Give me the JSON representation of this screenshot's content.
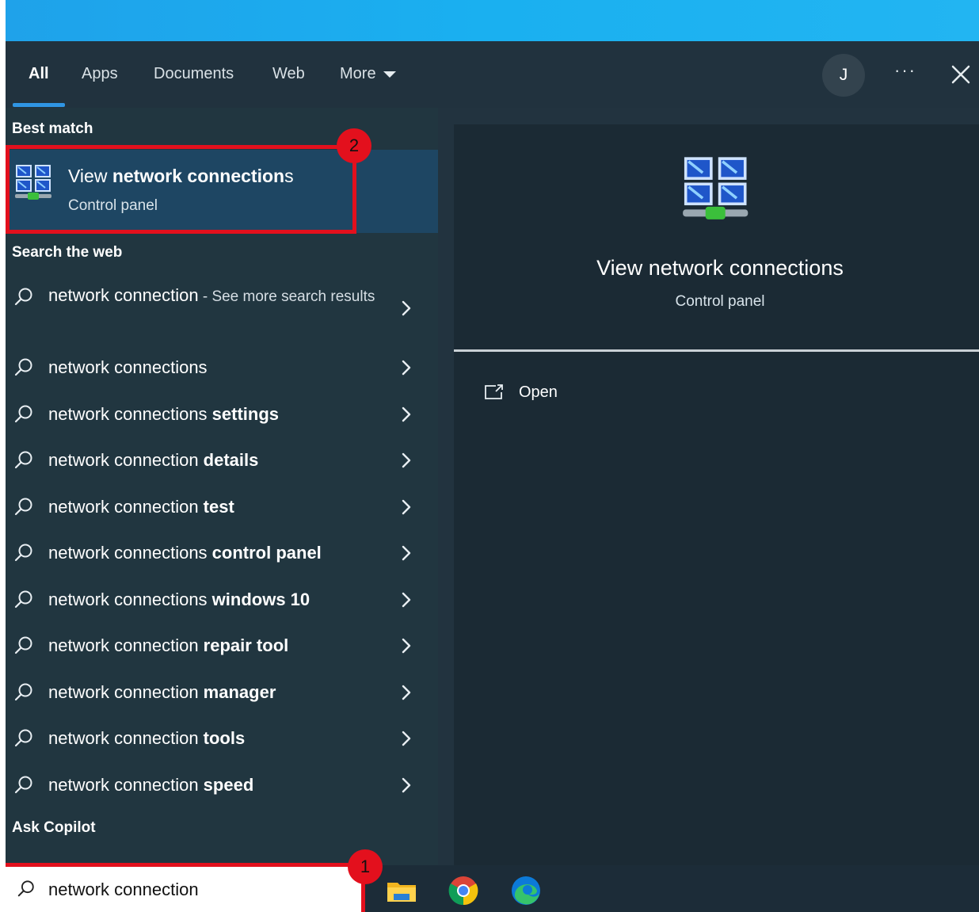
{
  "tabs": [
    {
      "label": "All",
      "active": true
    },
    {
      "label": "Apps"
    },
    {
      "label": "Documents"
    },
    {
      "label": "Web"
    },
    {
      "label": "More"
    }
  ],
  "user": {
    "initial": "J"
  },
  "more_options": "···",
  "sections": {
    "best_match": "Best match",
    "search_web": "Search the web",
    "ask_copilot": "Ask Copilot"
  },
  "best_match": {
    "title_plain": "View ",
    "title_bold": "network connection",
    "title_tail": "s",
    "subtitle": "Control panel"
  },
  "web_results": [
    {
      "prefix": "network connection",
      "suffix": " - See more search results",
      "bold": ""
    },
    {
      "prefix": "network connections",
      "bold": ""
    },
    {
      "prefix": "network connections ",
      "bold": "settings"
    },
    {
      "prefix": "network connection ",
      "bold": "details"
    },
    {
      "prefix": "network connection ",
      "bold": "test"
    },
    {
      "prefix": "network connections ",
      "bold": "control panel"
    },
    {
      "prefix": "network connections ",
      "bold": "windows 10"
    },
    {
      "prefix": "network connection ",
      "bold": "repair tool"
    },
    {
      "prefix": "network connection ",
      "bold": "manager"
    },
    {
      "prefix": "network connection ",
      "bold": "tools"
    },
    {
      "prefix": "network connection ",
      "bold": "speed"
    }
  ],
  "detail": {
    "title": "View network connections",
    "subtitle": "Control panel",
    "actions": [
      {
        "label": "Open",
        "icon": "open-external-icon"
      }
    ]
  },
  "search": {
    "query": "network connection"
  },
  "annotations": [
    {
      "label": "1"
    },
    {
      "label": "2"
    }
  ],
  "taskbar_icons": [
    "file-explorer-icon",
    "chrome-icon",
    "edge-icon"
  ],
  "colors": {
    "accent": "#2f95e3",
    "annotation": "#e3101d",
    "selected": "#1e4663"
  }
}
